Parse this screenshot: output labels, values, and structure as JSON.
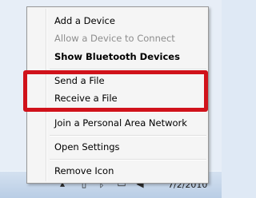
{
  "menu": {
    "items": [
      {
        "label": "Add a Device"
      },
      {
        "label": "Allow a Device to Connect"
      },
      {
        "label": "Show Bluetooth Devices"
      },
      {
        "label": "Send a File"
      },
      {
        "label": "Receive a File"
      },
      {
        "label": "Join a Personal Area Network"
      },
      {
        "label": "Open Settings"
      },
      {
        "label": "Remove Icon"
      }
    ]
  },
  "annotation": {
    "color": "#d0121b"
  },
  "taskbar": {
    "clock": "7/2/2010",
    "tray_icons": [
      "show-hidden-icons-icon",
      "flag-icon",
      "bluetooth-icon",
      "network-icon",
      "volume-icon"
    ]
  }
}
